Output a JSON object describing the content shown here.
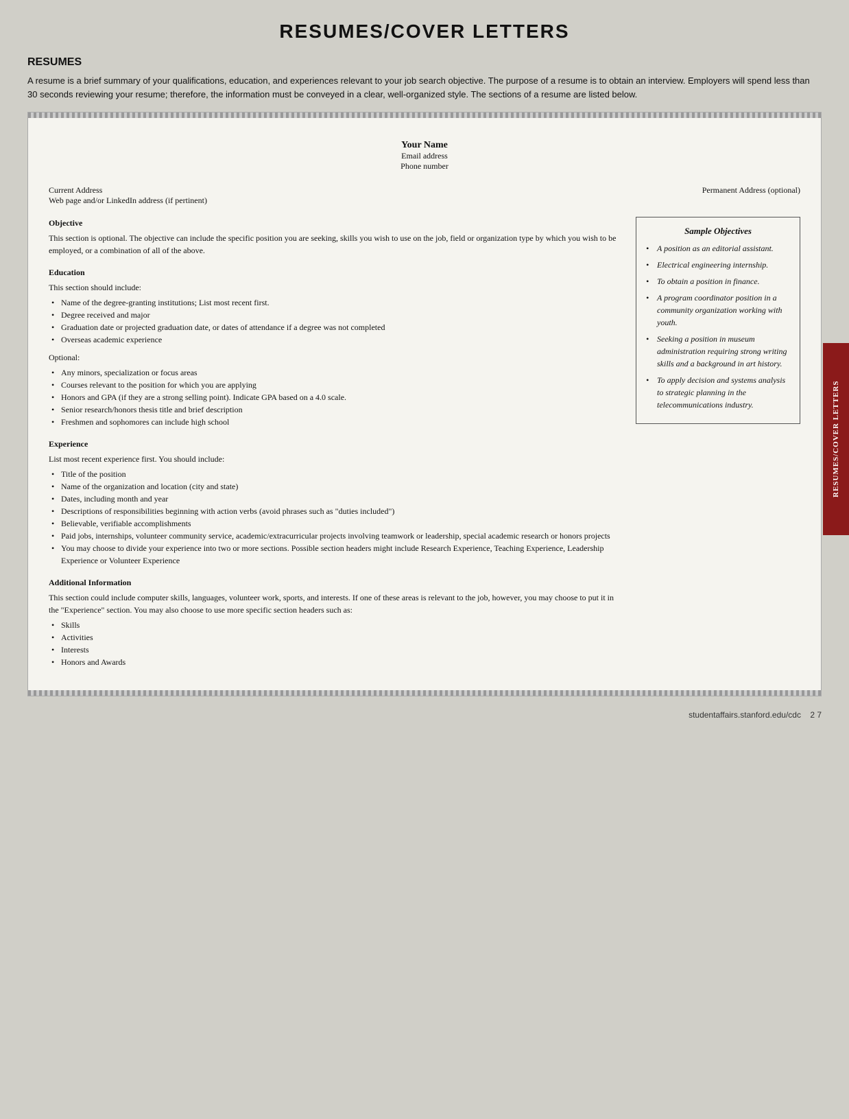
{
  "page": {
    "title": "RESUMES/COVER LETTERS",
    "side_tab_label": "RESUMES/COVER LETTERS",
    "footer_url": "studentaffairs.stanford.edu/cdc",
    "footer_page": "2 7"
  },
  "resumes_section": {
    "heading": "RESUMES",
    "intro": "A resume is a brief summary of your qualifications, education, and experiences relevant to your job search objective. The purpose of a resume is to obtain an interview. Employers will spend less than 30 seconds reviewing your resume; therefore, the information must be conveyed in a clear, well-organized style. The sections of a resume are listed below."
  },
  "resume_template": {
    "name": "Your Name",
    "email": "Email address",
    "phone": "Phone number",
    "current_address": "Current Address",
    "web_address": "Web page and/or LinkedIn address (if pertinent)",
    "permanent_address": "Permanent Address (optional)"
  },
  "objective_section": {
    "title": "Objective",
    "body": "This section is optional. The objective can include the specific position you are seeking, skills you wish to use on the job, field or organization type by which you wish to be employed, or a combination of all of the above."
  },
  "education_section": {
    "title": "Education",
    "intro": "This section should include:",
    "items": [
      "Name of the degree-granting institutions; List most recent first.",
      "Degree received and major",
      "Graduation date or projected graduation date, or dates of attendance if a degree was not completed",
      "Overseas academic experience"
    ],
    "optional_label": "Optional:",
    "optional_items": [
      "Any minors, specialization or focus areas",
      "Courses relevant to the position for which you are applying",
      "Honors and GPA (if they are a strong selling point). Indicate GPA based on a 4.0 scale.",
      "Senior research/honors thesis title and brief description",
      "Freshmen and sophomores can include high school"
    ]
  },
  "experience_section": {
    "title": "Experience",
    "intro": "List most recent experience first. You should include:",
    "items": [
      "Title of the position",
      "Name of the organization and location (city and state)",
      "Dates, including month and year",
      "Descriptions of responsibilities beginning with action verbs (avoid phrases such as \"duties included\")",
      "Believable, verifiable accomplishments",
      "Paid jobs, internships, volunteer community service, academic/extracurricular projects involving teamwork or leadership, special academic research or honors projects",
      "You may choose to divide your experience into two or more sections. Possible section headers might include Research Experience, Teaching Experience, Leadership Experience or Volunteer Experience"
    ]
  },
  "additional_section": {
    "title": "Additional Information",
    "body": "This section could include computer skills, languages, volunteer work, sports, and interests. If one of these areas is relevant to the job, however, you may choose to put it in the \"Experience\" section. You may also choose to use more specific section headers such as:",
    "items": [
      "Skills",
      "Activities",
      "Interests",
      "Honors and Awards"
    ]
  },
  "sample_objectives": {
    "title": "Sample Objectives",
    "items": [
      "A position as an editorial assistant.",
      "Electrical engineering internship.",
      "To obtain a position in finance.",
      "A program coordinator position in a community organization working with youth.",
      "Seeking a position in museum administration requiring strong writing skills and a background in art history.",
      "To apply decision and systems analysis to strategic planning in the telecommunications industry."
    ]
  }
}
